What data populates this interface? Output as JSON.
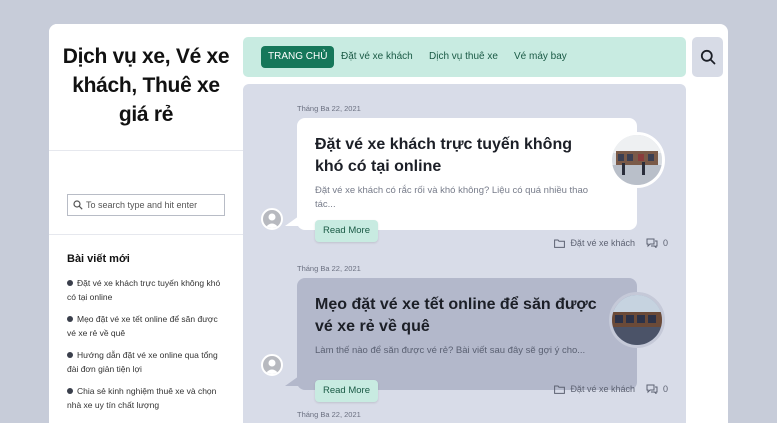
{
  "site": {
    "title": "Dịch vụ xe, Vé xe khách, Thuê xe giá rẻ"
  },
  "nav": {
    "items": [
      {
        "label": "TRANG CHỦ",
        "active": true
      },
      {
        "label": "Đặt vé xe khách"
      },
      {
        "label": "Dịch vụ thuê xe"
      },
      {
        "label": "Vé máy bay"
      }
    ]
  },
  "sidebar": {
    "search": {
      "placeholder": "To search type and hit enter"
    },
    "recent": {
      "heading": "Bài viết mới",
      "items": [
        "Đặt vé xe khách trực tuyến không khó có tại online",
        "Mẹo đặt vé xe tết online để săn được vé xe rẻ về quê",
        "Hướng dẫn đặt vé xe online qua tổng đài đơn giản tiện lợi",
        "Chia sẻ kinh nghiệm thuê xe và chọn nhà xe uy tín chất lượng"
      ]
    }
  },
  "posts": [
    {
      "date": "Tháng Ba 22, 2021",
      "title": "Đặt vé xe khách trực tuyến không khó có tại online",
      "excerpt": "Đặt vé xe khách có rắc rối và khó không? Liệu có quá nhiều thao tác...",
      "read_more": "Read More",
      "category": "Đặt vé xe khách",
      "comments": "0"
    },
    {
      "date": "Tháng Ba 22, 2021",
      "title": "Mẹo đặt vé xe tết online để săn được vé xe rẻ về quê",
      "excerpt": "Làm thế nào để săn được vé rẻ? Bài viết sau đây sẽ gợi ý cho...",
      "read_more": "Read More",
      "category": "Đặt vé xe khách",
      "comments": "0"
    },
    {
      "date": "Tháng Ba 22, 2021"
    }
  ],
  "colors": {
    "accent": "#16775a",
    "nav_bg": "#c8ebe1",
    "feed_bg": "#d8dce8"
  }
}
